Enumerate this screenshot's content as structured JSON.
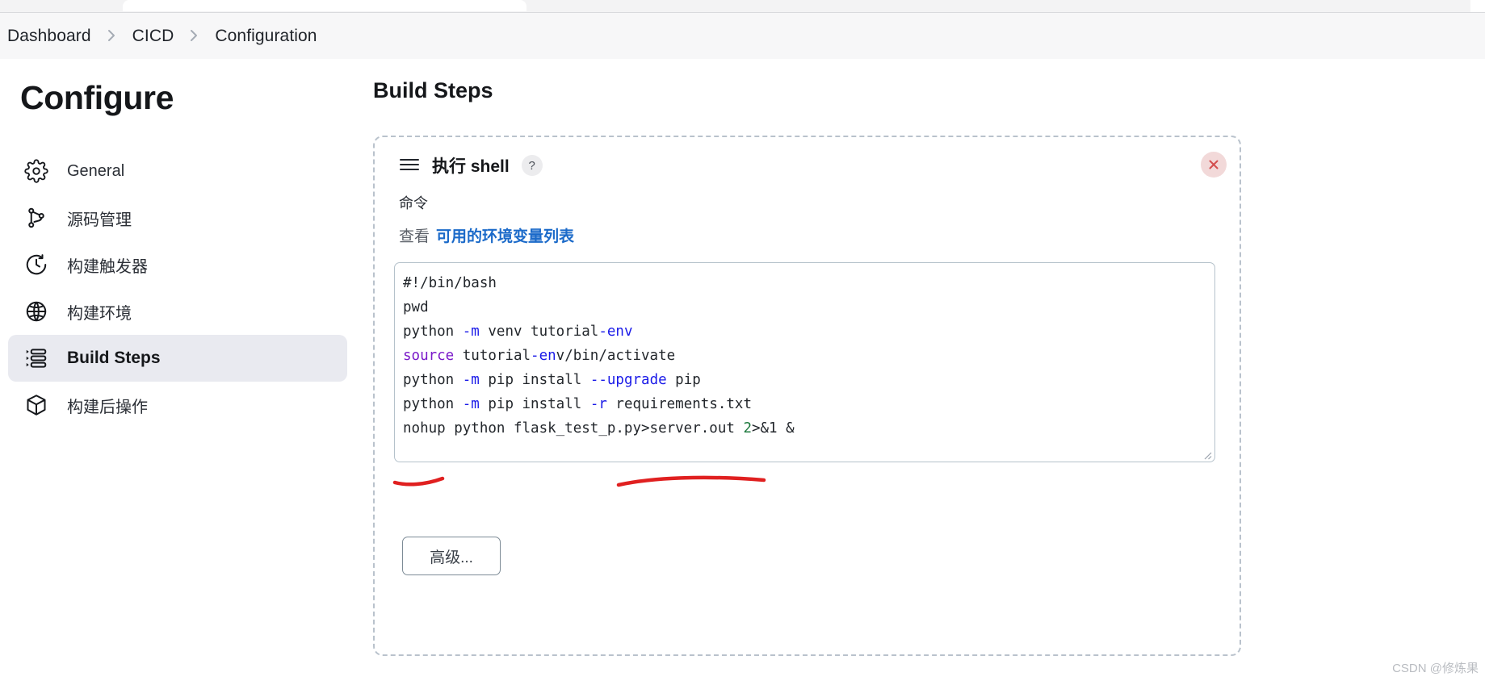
{
  "breadcrumb": {
    "items": [
      {
        "label": "Dashboard"
      },
      {
        "label": "CICD"
      },
      {
        "label": "Configuration"
      }
    ]
  },
  "sidebar": {
    "title": "Configure",
    "items": [
      {
        "label": "General",
        "icon": "gear-icon",
        "active": false
      },
      {
        "label": "源码管理",
        "icon": "git-branch-icon",
        "active": false
      },
      {
        "label": "构建触发器",
        "icon": "clock-icon",
        "active": false
      },
      {
        "label": "构建环境",
        "icon": "globe-icon",
        "active": false
      },
      {
        "label": "Build Steps",
        "icon": "list-steps-icon",
        "active": true
      },
      {
        "label": "构建后操作",
        "icon": "package-icon",
        "active": false
      }
    ]
  },
  "main": {
    "title": "Build Steps",
    "step": {
      "title": "执行 shell",
      "help_label": "?",
      "close_label": "×",
      "drag_handle_name": "hamburger-drag-icon",
      "command_label": "命令",
      "env_prefix": "查看",
      "env_link": "可用的环境变量列表",
      "advanced_button": "高级...",
      "command_lines": [
        "#!/bin/bash",
        "pwd",
        "python -m venv tutorial-env",
        "source tutorial-env/bin/activate",
        "python -m pip install --upgrade pip",
        "python -m pip install -r requirements.txt",
        "nohup python flask_test_p.py>server.out 2>&1 &"
      ]
    }
  },
  "annotations": {
    "underline_color": "#e02020",
    "marks": [
      {
        "name": "nohup-underline"
      },
      {
        "name": "redirect-underline"
      }
    ]
  },
  "watermark": "CSDN @修炼果",
  "colors": {
    "accent_link": "#1b6ac9",
    "active_nav_bg": "#e9eaf0",
    "breadcrumb_bg": "#f7f7f8",
    "card_border": "#b9c2cc",
    "close_bg": "#f2d9d9",
    "close_fg": "#d34e4e",
    "annotation_red": "#e02020"
  }
}
